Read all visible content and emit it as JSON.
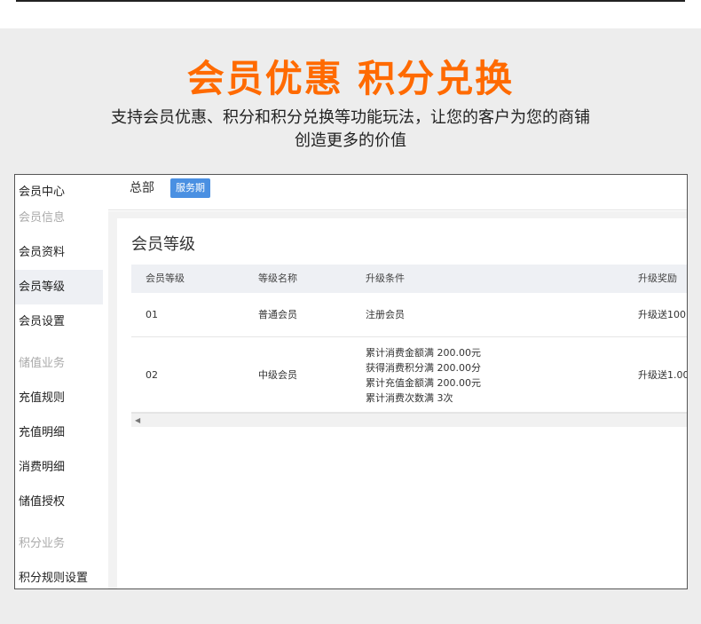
{
  "hero": {
    "title": "会员优惠 积分兑换",
    "subtitle_line1": "支持会员优惠、积分和积分兑换等功能玩法，让您的客户为您的商铺",
    "subtitle_line2": "创造更多的价值"
  },
  "sidebar": {
    "items": [
      {
        "label": "会员中心",
        "type": "item"
      },
      {
        "label": "会员信息",
        "type": "group"
      },
      {
        "label": "会员资料",
        "type": "item"
      },
      {
        "label": "会员等级",
        "type": "active"
      },
      {
        "label": "会员设置",
        "type": "item"
      },
      {
        "label": "储值业务",
        "type": "group"
      },
      {
        "label": "充值规则",
        "type": "item"
      },
      {
        "label": "充值明细",
        "type": "item"
      },
      {
        "label": "消费明细",
        "type": "item"
      },
      {
        "label": "储值授权",
        "type": "item"
      },
      {
        "label": "积分业务",
        "type": "group"
      },
      {
        "label": "积分规则设置",
        "type": "item"
      }
    ]
  },
  "header": {
    "store": "总部",
    "badge": "服务期"
  },
  "panel": {
    "title": "会员等级"
  },
  "table": {
    "columns": [
      "会员等级",
      "等级名称",
      "升级条件",
      "升级奖励"
    ],
    "rows": [
      {
        "level": "01",
        "name": "普通会员",
        "conditions": [
          "注册会员"
        ],
        "reward": "升级送100"
      },
      {
        "level": "02",
        "name": "中级会员",
        "conditions": [
          "累计消费金额满 200.00元",
          "获得消费积分满 200.00分",
          "累计充值金额满 200.00元",
          "累计消费次数满 3次"
        ],
        "reward": "升级送1.00"
      }
    ]
  },
  "colors": {
    "accent": "#ff6a00",
    "badge": "#4a90e2"
  }
}
